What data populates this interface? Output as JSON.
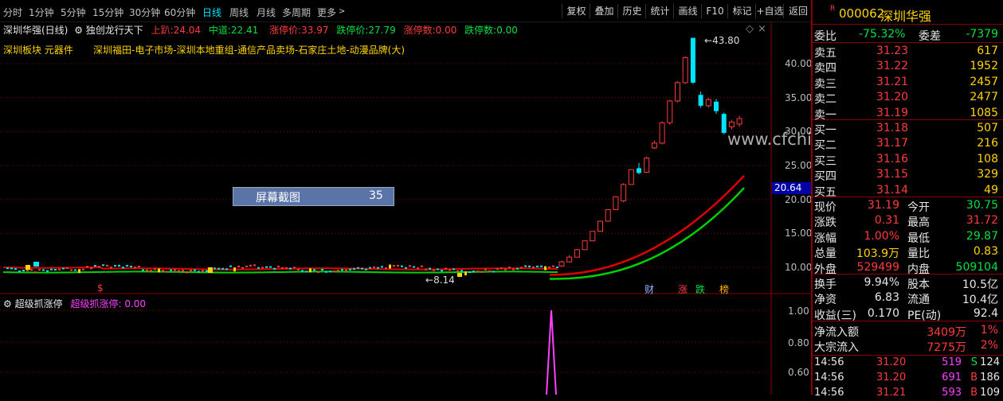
{
  "period_tabs": [
    "分时",
    "1分钟",
    "5分钟",
    "15分钟",
    "30分钟",
    "60分钟",
    "日线",
    "周线",
    "月线",
    "多周期",
    "更多"
  ],
  "toolbar": [
    "复权",
    "叠加",
    "历史",
    "统计",
    "画线",
    "F10",
    "标记",
    "+自选",
    "返回"
  ],
  "main_chart": {
    "title": "深圳华强(日线)",
    "indicator": "独创龙行天下",
    "upper_label": "上趴:",
    "upper_value": "24.04",
    "mid_label": "中道:",
    "mid_value": "22.41",
    "limit_up_label": "涨停价:",
    "limit_up_value": "33.97",
    "limit_down_label": "跌停价:",
    "limit_down_value": "27.79",
    "up_count_label": "涨停数:",
    "up_count_value": "0.00",
    "down_count_label": "跌停数:",
    "down_count_value": "0.00",
    "sector": "深圳板块  元器件",
    "concepts": "深圳福田-电子市场-深圳本地重组-通信产品卖场-石家庄土地-动漫品牌(大)",
    "high_label": "43.80",
    "low_label": "8.14",
    "current_price_tag": "20.64",
    "y_ticks": [
      "40.00",
      "35.00",
      "30.00",
      "25.00",
      "20.00",
      "15.00",
      "10.00"
    ],
    "event_markers": [
      "财",
      "涨",
      "跌",
      "榜"
    ],
    "s_marker": "$",
    "watermark": "www.cfchi.com"
  },
  "popup": {
    "label": "屏幕截图",
    "value": "35"
  },
  "sub_chart": {
    "title": "超级抓涨停",
    "series_label": "超级抓涨停:",
    "series_value": "0.00",
    "y_ticks": [
      "1.00",
      "0.80",
      "0.60"
    ]
  },
  "colors": {
    "up": "#ff3b3b",
    "down": "#00e5ff",
    "ma1": "#e00000",
    "ma2": "#00d000",
    "grid": "#8b0000",
    "spike": "#ff40ff"
  },
  "chart_data": {
    "type": "candlestick",
    "ylim": [
      8,
      45
    ],
    "candles": [
      {
        "o": 10.2,
        "c": 10.8,
        "h": 11.0,
        "l": 10.1
      },
      {
        "o": 10.8,
        "c": 11.5,
        "h": 11.8,
        "l": 10.7
      },
      {
        "o": 11.5,
        "c": 12.6,
        "h": 12.7,
        "l": 11.5
      },
      {
        "o": 12.6,
        "c": 13.9,
        "h": 13.9,
        "l": 12.6
      },
      {
        "o": 13.9,
        "c": 15.3,
        "h": 15.3,
        "l": 13.9
      },
      {
        "o": 15.3,
        "c": 16.8,
        "h": 16.8,
        "l": 15.3
      },
      {
        "o": 16.8,
        "c": 18.5,
        "h": 18.5,
        "l": 16.8
      },
      {
        "o": 18.5,
        "c": 20.4,
        "h": 20.4,
        "l": 18.5
      },
      {
        "o": 19.8,
        "c": 22.2,
        "h": 22.4,
        "l": 19.6
      },
      {
        "o": 22.2,
        "c": 24.4,
        "h": 24.4,
        "l": 22.2
      },
      {
        "o": 24.6,
        "c": 23.9,
        "h": 25.4,
        "l": 23.7
      },
      {
        "o": 24.0,
        "c": 26.1,
        "h": 26.3,
        "l": 23.9
      },
      {
        "o": 27.6,
        "c": 28.3,
        "h": 28.7,
        "l": 27.4
      },
      {
        "o": 28.3,
        "c": 31.3,
        "h": 31.5,
        "l": 28.1
      },
      {
        "o": 31.3,
        "c": 34.5,
        "h": 34.7,
        "l": 31.0
      },
      {
        "o": 34.5,
        "c": 37.2,
        "h": 37.4,
        "l": 34.3
      },
      {
        "o": 37.2,
        "c": 40.9,
        "h": 41.1,
        "l": 37.0
      },
      {
        "o": 43.8,
        "c": 37.2,
        "h": 43.8,
        "l": 37.0
      },
      {
        "o": 35.4,
        "c": 33.8,
        "h": 35.9,
        "l": 33.5
      },
      {
        "o": 33.8,
        "c": 34.7,
        "h": 35.0,
        "l": 33.5
      },
      {
        "o": 34.4,
        "c": 33.0,
        "h": 34.8,
        "l": 32.6
      },
      {
        "o": 32.6,
        "c": 29.8,
        "h": 32.8,
        "l": 29.6
      },
      {
        "o": 30.7,
        "c": 31.4,
        "h": 31.7,
        "l": 30.3
      },
      {
        "o": 31.1,
        "c": 31.9,
        "h": 32.3,
        "l": 30.7
      }
    ],
    "sub_series": [
      0.0,
      1.0,
      0.0
    ]
  },
  "quote": {
    "badge": "R",
    "code": "000062",
    "name": "深圳华强",
    "weibi_label": "委比",
    "weibi_value": "-75.32%",
    "weicha_label": "委差",
    "weicha_value": "-7379",
    "asks": [
      {
        "label": "卖五",
        "price": "31.23",
        "vol": "617"
      },
      {
        "label": "卖四",
        "price": "31.22",
        "vol": "1952"
      },
      {
        "label": "卖三",
        "price": "31.21",
        "vol": "2457"
      },
      {
        "label": "卖二",
        "price": "31.20",
        "vol": "2477"
      },
      {
        "label": "卖一",
        "price": "31.19",
        "vol": "1085"
      }
    ],
    "bids": [
      {
        "label": "买一",
        "price": "31.18",
        "vol": "507"
      },
      {
        "label": "买二",
        "price": "31.17",
        "vol": "216"
      },
      {
        "label": "买三",
        "price": "31.16",
        "vol": "108"
      },
      {
        "label": "买四",
        "price": "31.15",
        "vol": "329"
      },
      {
        "label": "买五",
        "price": "31.14",
        "vol": "49"
      }
    ],
    "stats": [
      {
        "l1": "现价",
        "v1": "31.19",
        "l2": "今开",
        "v2": "30.75"
      },
      {
        "l1": "涨跌",
        "v1": "0.31",
        "l2": "最高",
        "v2": "31.72"
      },
      {
        "l1": "涨幅",
        "v1": "1.00%",
        "l2": "最低",
        "v2": "29.87"
      },
      {
        "l1": "总量",
        "v1": "103.9万",
        "l2": "量比",
        "v2": "0.83"
      },
      {
        "l1": "外盘",
        "v1": "529499",
        "l2": "内盘",
        "v2": "509104"
      }
    ],
    "stats2": [
      {
        "l1": "换手",
        "v1": "9.94%",
        "l2": "股本",
        "v2": "10.5亿"
      },
      {
        "l1": "净资",
        "v1": "6.83",
        "l2": "流通",
        "v2": "10.4亿"
      },
      {
        "l1": "收益(三)",
        "v1": "0.170",
        "l2": "PE(动)",
        "v2": "92.4"
      }
    ],
    "flow": [
      {
        "label": "净流入额",
        "value": "3409万",
        "pct": "1%"
      },
      {
        "label": "大宗流入",
        "value": "7275万",
        "pct": "2%"
      }
    ],
    "ticks": [
      {
        "time": "14:56",
        "price": "31.20",
        "vol": "519",
        "side": "S",
        "n": "124"
      },
      {
        "time": "14:56",
        "price": "31.20",
        "vol": "691",
        "side": "B",
        "n": "186"
      },
      {
        "time": "14:56",
        "price": "31.21",
        "vol": "593",
        "side": "B",
        "n": "109"
      }
    ]
  }
}
